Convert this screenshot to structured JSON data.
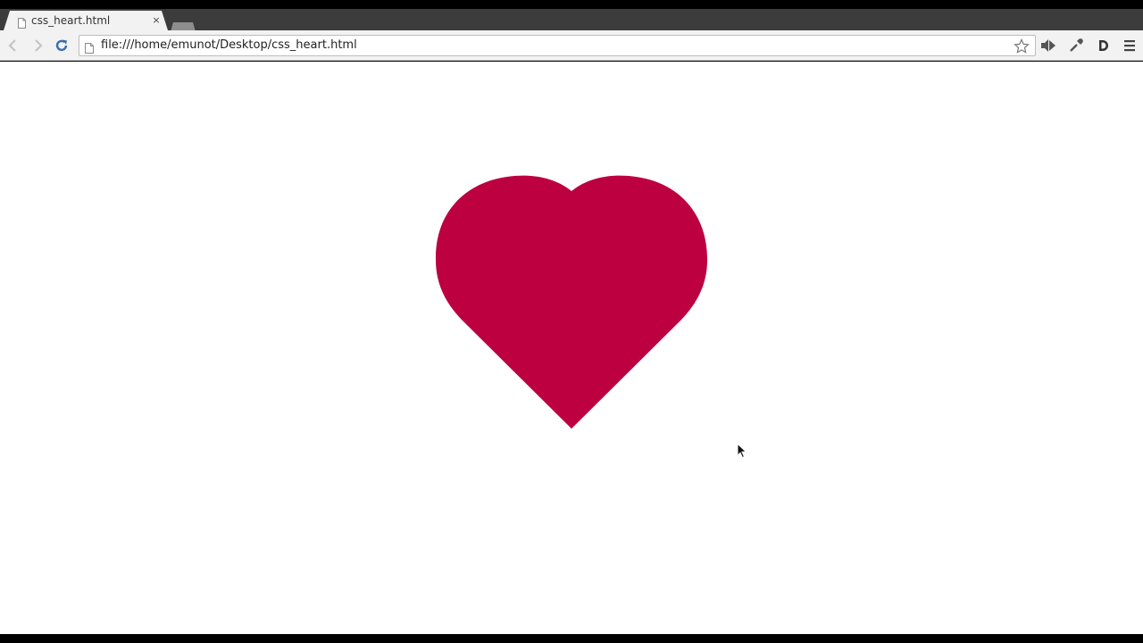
{
  "browser": {
    "tab": {
      "title": "css_heart.html",
      "close_glyph": "×",
      "icon": "page-icon"
    },
    "new_tab_icon": "new-tab-icon",
    "toolbar": {
      "back_icon": "back-arrow-icon",
      "forward_icon": "forward-arrow-icon",
      "reload_icon": "reload-icon",
      "url": "file:///home/emunot/Desktop/css_heart.html",
      "bookmark_icon": "star-icon",
      "extensions": [
        "audio-extension-icon",
        "eyedropper-extension-icon",
        "dashlane-extension-icon"
      ],
      "menu_icon": "hamburger-menu-icon"
    }
  },
  "page": {
    "background": "#ffffff",
    "heart_color": "#bc0040"
  },
  "colors": {
    "tab_strip": "#3c3c3c",
    "toolbar": "#f2f2f2",
    "reload_blue": "#3a6fb0"
  }
}
